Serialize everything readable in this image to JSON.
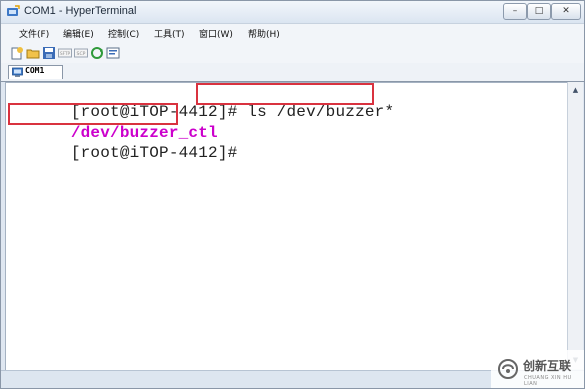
{
  "window": {
    "title": "COM1 - HyperTerminal",
    "controls": {
      "minimize": "–",
      "maximize": "□",
      "close": "✕"
    }
  },
  "menu": {
    "items": [
      {
        "label": "文件(F)"
      },
      {
        "label": "编辑(E)"
      },
      {
        "label": "控制(C)"
      },
      {
        "label": "工具(T)"
      },
      {
        "label": "窗口(W)"
      },
      {
        "label": "帮助(H)"
      }
    ]
  },
  "toolbar": {
    "icons": [
      "new-session-icon",
      "open-folder-icon",
      "save-icon",
      "sftp-icon",
      "scp-icon",
      "reconnect-icon",
      "properties-icon"
    ],
    "sftp_label": "SFTP",
    "scp_label": "SCP"
  },
  "tabs": [
    {
      "label": "COM1",
      "icon": "terminal-tab-icon"
    }
  ],
  "terminal": {
    "lines": [
      {
        "prompt": "[root@iTOP-4412]#",
        "command": "ls /dev/buzzer*"
      },
      {
        "output": "/dev/buzzer_ctl"
      },
      {
        "prompt": "[root@iTOP-4412]#",
        "command": ""
      }
    ],
    "colors": {
      "text": "#222222",
      "output": "#cc00cc",
      "highlight": "#d9323f"
    }
  },
  "watermark": {
    "name_cn": "创新互联",
    "name_en": "CHUANG XIN HU LIAN"
  }
}
